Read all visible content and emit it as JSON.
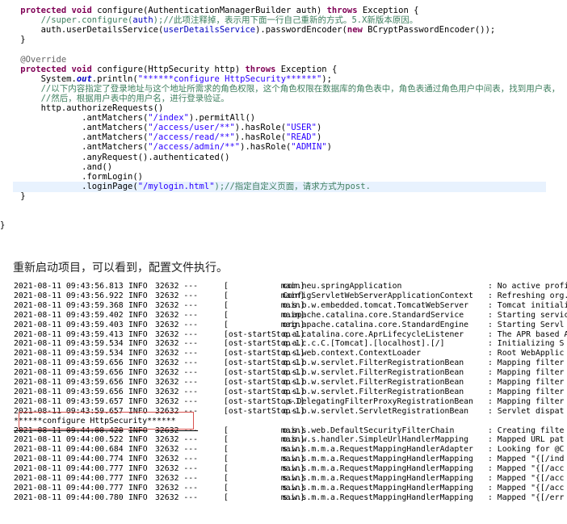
{
  "code": {
    "lines": [
      [
        {
          "t": "    protected ",
          "c": "kw"
        },
        {
          "t": "void",
          "c": "kw"
        },
        {
          "t": " configure(AuthenticationManagerBuilder auth) "
        },
        {
          "t": "throws",
          "c": "kw"
        },
        {
          "t": " Exception {"
        }
      ],
      [
        {
          "t": "        //super.configure(",
          "c": "cm"
        },
        {
          "t": "auth",
          "c": "fld"
        },
        {
          "t": ");//此项注释掉，表示用下面一行自己重新的方式。5.X新版本原因。",
          "c": "cm"
        }
      ],
      [
        {
          "t": "        auth.userDetailsService("
        },
        {
          "t": "userDetailsService",
          "c": "fld"
        },
        {
          "t": ").passwordEncoder("
        },
        {
          "t": "new",
          "c": "kw"
        },
        {
          "t": " BCryptPasswordEncoder());"
        }
      ],
      [
        {
          "t": "    }"
        }
      ],
      [
        {
          "t": ""
        }
      ],
      [
        {
          "t": "    @Override",
          "c": "ann"
        }
      ],
      [
        {
          "t": "    protected ",
          "c": "kw"
        },
        {
          "t": "void",
          "c": "kw"
        },
        {
          "t": " configure(HttpSecurity http) "
        },
        {
          "t": "throws",
          "c": "kw"
        },
        {
          "t": " Exception {"
        }
      ],
      [
        {
          "t": "        System."
        },
        {
          "t": "out",
          "c": "it"
        },
        {
          "t": ".println("
        },
        {
          "t": "\"******configure HttpSecurity******\"",
          "c": "str"
        },
        {
          "t": ");"
        }
      ],
      [
        {
          "t": "        //以下内容指定了登录地址与这个地址所需求的角色权限，这个角色权限在数据库的角色表中，角色表通过角色用户中间表，找到用户表，",
          "c": "cm"
        }
      ],
      [
        {
          "t": "        //然后，根据用户表中的用户名，进行登录验证。",
          "c": "cm"
        }
      ],
      [
        {
          "t": "        http.authorizeRequests()"
        }
      ],
      [
        {
          "t": "                .antMatchers("
        },
        {
          "t": "\"/index\"",
          "c": "str"
        },
        {
          "t": ").permitAll()"
        }
      ],
      [
        {
          "t": "                .antMatchers("
        },
        {
          "t": "\"/access/user/**\"",
          "c": "str"
        },
        {
          "t": ").hasRole("
        },
        {
          "t": "\"USER\"",
          "c": "str"
        },
        {
          "t": ")"
        }
      ],
      [
        {
          "t": "                .antMatchers("
        },
        {
          "t": "\"/access/read/**\"",
          "c": "str"
        },
        {
          "t": ").hasRole("
        },
        {
          "t": "\"READ\"",
          "c": "str"
        },
        {
          "t": ")"
        }
      ],
      [
        {
          "t": "                .antMatchers("
        },
        {
          "t": "\"/access/admin/**\"",
          "c": "str"
        },
        {
          "t": ").hasRole("
        },
        {
          "t": "\"ADMIN\"",
          "c": "str"
        },
        {
          "t": ")"
        }
      ],
      [
        {
          "t": "                .anyRequest().authenticated()"
        }
      ],
      [
        {
          "t": "                .and()"
        }
      ],
      [
        {
          "t": "                .formLogin()"
        }
      ],
      [
        {
          "t": "                .loginPage("
        },
        {
          "t": "\"/mylogin.html\"",
          "c": "str"
        },
        {
          "t": ");//指定自定义页面，请求方式为post.",
          "c": "cm"
        }
      ],
      [
        {
          "t": "    }"
        }
      ],
      [
        {
          "t": ""
        }
      ],
      [
        {
          "t": ""
        }
      ],
      [
        {
          "t": "}"
        }
      ]
    ],
    "highlighted_line": 18
  },
  "caption": "重新启动项目，可以看到，配置文件执行。",
  "console": {
    "lines": [
      {
        "ts": "2021-08-11 09:43:56.813",
        "lvl": "INFO",
        "pid": "32632 ---",
        "thread": "[           main]",
        "logger": "com.neu.springApplication",
        "msg": ": No active profile"
      },
      {
        "ts": "2021-08-11 09:43:56.922",
        "lvl": "INFO",
        "pid": "32632 ---",
        "thread": "[           main]",
        "logger": "ConfigServletWebServerApplicationContext",
        "msg": ": Refreshing org.s"
      },
      {
        "ts": "2021-08-11 09:43:59.368",
        "lvl": "INFO",
        "pid": "32632 ---",
        "thread": "[           main]",
        "logger": "o.s.b.w.embedded.tomcat.TomcatWebServer",
        "msg": ": Tomcat initiali"
      },
      {
        "ts": "2021-08-11 09:43:59.402",
        "lvl": "INFO",
        "pid": "32632 ---",
        "thread": "[           main]",
        "logger": "o.apache.catalina.core.StandardService",
        "msg": ": Starting servic"
      },
      {
        "ts": "2021-08-11 09:43:59.403",
        "lvl": "INFO",
        "pid": "32632 ---",
        "thread": "[           main]",
        "logger": "org.apache.catalina.core.StandardEngine",
        "msg": ": Starting Servl"
      },
      {
        "ts": "2021-08-11 09:43:59.413",
        "lvl": "INFO",
        "pid": "32632 ---",
        "thread": "[ost-startStop-1]",
        "logger": "o.a.catalina.core.AprLifecycleListener",
        "msg": ": The APR based A"
      },
      {
        "ts": "2021-08-11 09:43:59.534",
        "lvl": "INFO",
        "pid": "32632 ---",
        "thread": "[ost-startStop-1]",
        "logger": "o.a.c.c.C.[Tomcat].[localhost].[/]",
        "msg": ": Initializing S"
      },
      {
        "ts": "2021-08-11 09:43:59.534",
        "lvl": "INFO",
        "pid": "32632 ---",
        "thread": "[ost-startStop-1]",
        "logger": "o.s.web.context.ContextLoader",
        "msg": ": Root WebApplic"
      },
      {
        "ts": "2021-08-11 09:43:59.656",
        "lvl": "INFO",
        "pid": "32632 ---",
        "thread": "[ost-startStop-1]",
        "logger": "o.s.b.w.servlet.FilterRegistrationBean",
        "msg": ": Mapping filter"
      },
      {
        "ts": "2021-08-11 09:43:59.656",
        "lvl": "INFO",
        "pid": "32632 ---",
        "thread": "[ost-startStop-1]",
        "logger": "o.s.b.w.servlet.FilterRegistrationBean",
        "msg": ": Mapping filter"
      },
      {
        "ts": "2021-08-11 09:43:59.656",
        "lvl": "INFO",
        "pid": "32632 ---",
        "thread": "[ost-startStop-1]",
        "logger": "o.s.b.w.servlet.FilterRegistrationBean",
        "msg": ": Mapping filter"
      },
      {
        "ts": "2021-08-11 09:43:59.656",
        "lvl": "INFO",
        "pid": "32632 ---",
        "thread": "[ost-startStop-1]",
        "logger": "o.s.b.w.servlet.FilterRegistrationBean",
        "msg": ": Mapping filter"
      },
      {
        "ts": "2021-08-11 09:43:59.657",
        "lvl": "INFO",
        "pid": "32632 ---",
        "thread": "[ost-startStop-1]",
        "logger": ".s.DelegatingFilterProxyRegistrationBean",
        "msg": ": Mapping filter"
      },
      {
        "ts": "2021-08-11 09:43:59.657",
        "lvl": "INFO",
        "pid": "32632 ---",
        "thread": "[ost-startStop-1]",
        "logger": "o.s.b.w.servlet.ServletRegistrationBean",
        "msg": ": Servlet dispat"
      },
      {
        "raw": "******configure HttpSecurity******"
      },
      {
        "ts": "2021-08-11 09:44:00.420",
        "lvl": "INFO",
        "pid": "32632 ---",
        "thread": "[           main]",
        "logger": "o.s.s.web.DefaultSecurityFilterChain",
        "msg": ": Creating filte",
        "strike": true
      },
      {
        "ts": "2021-08-11 09:44:00.522",
        "lvl": "INFO",
        "pid": "32632 ---",
        "thread": "[           main]",
        "logger": "o.s.w.s.handler.SimpleUrlHandlerMapping",
        "msg": ": Mapped URL pat"
      },
      {
        "ts": "2021-08-11 09:44:00.684",
        "lvl": "INFO",
        "pid": "32632 ---",
        "thread": "[           main]",
        "logger": "s.w.s.m.m.a.RequestMappingHandlerAdapter",
        "msg": ": Looking for @C"
      },
      {
        "ts": "2021-08-11 09:44:00.774",
        "lvl": "INFO",
        "pid": "32632 ---",
        "thread": "[           main]",
        "logger": "s.w.s.m.m.a.RequestMappingHandlerMapping",
        "msg": ": Mapped \"{[/ind"
      },
      {
        "ts": "2021-08-11 09:44:00.777",
        "lvl": "INFO",
        "pid": "32632 ---",
        "thread": "[           main]",
        "logger": "s.w.s.m.m.a.RequestMappingHandlerMapping",
        "msg": ": Mapped \"{[/acc"
      },
      {
        "ts": "2021-08-11 09:44:00.777",
        "lvl": "INFO",
        "pid": "32632 ---",
        "thread": "[           main]",
        "logger": "s.w.s.m.m.a.RequestMappingHandlerMapping",
        "msg": ": Mapped \"{[/acc"
      },
      {
        "ts": "2021-08-11 09:44:00.777",
        "lvl": "INFO",
        "pid": "32632 ---",
        "thread": "[           main]",
        "logger": "s.w.s.m.m.a.RequestMappingHandlerMapping",
        "msg": ": Mapped \"{[/acc"
      },
      {
        "ts": "2021-08-11 09:44:00.780",
        "lvl": "INFO",
        "pid": "32632 ---",
        "thread": "[           main]",
        "logger": "s.w.s.m.m.a.RequestMappingHandlerMapping",
        "msg": ": Mapped \"{[/err"
      }
    ]
  }
}
